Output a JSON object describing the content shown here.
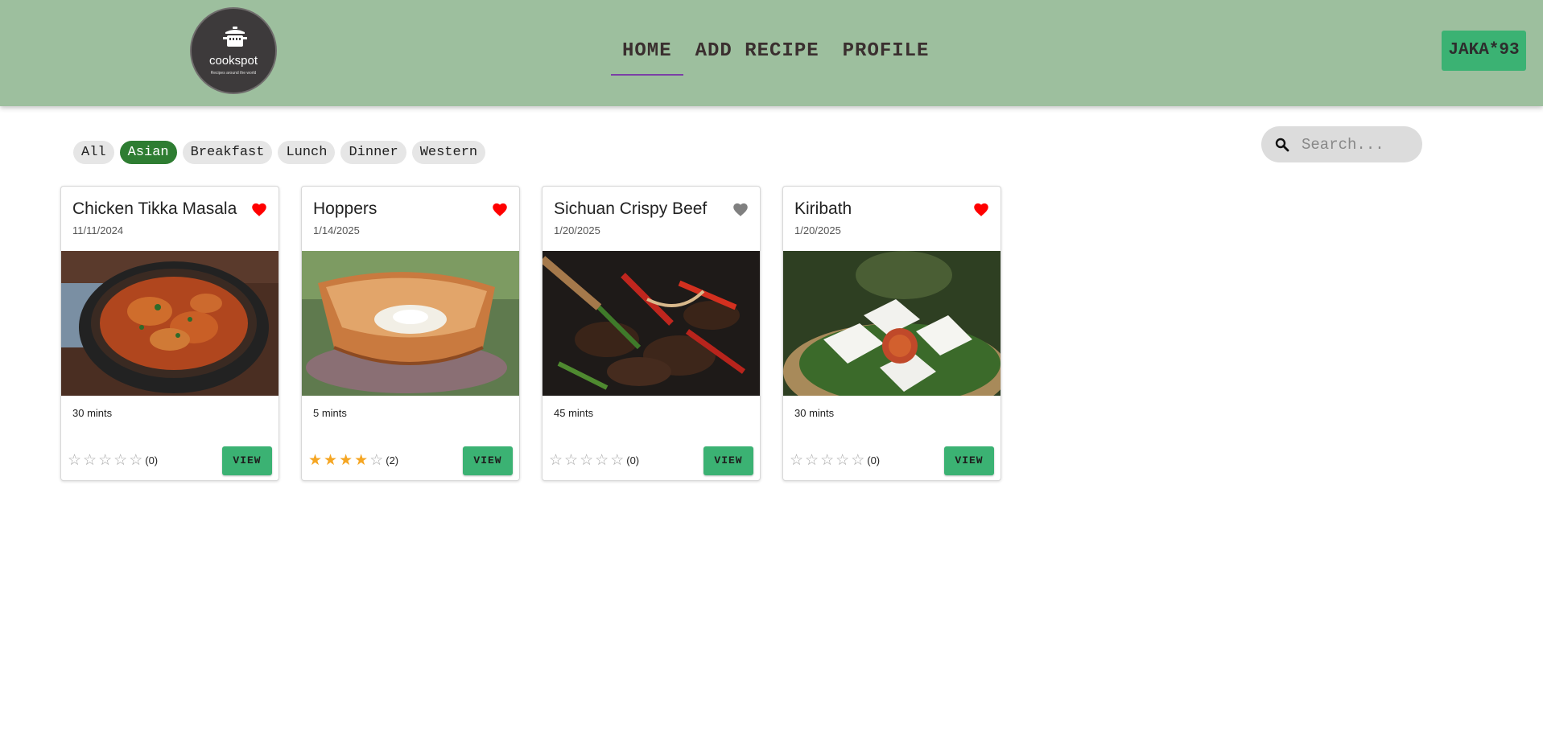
{
  "header": {
    "logo": {
      "name": "cookspot",
      "tagline": "Recipes around the world"
    },
    "nav": [
      {
        "label": "HOME",
        "active": true
      },
      {
        "label": "ADD RECIPE",
        "active": false
      },
      {
        "label": "PROFILE",
        "active": false
      }
    ],
    "user_label": "JAKA*93"
  },
  "filters": [
    {
      "label": "All",
      "active": false
    },
    {
      "label": "Asian",
      "active": true
    },
    {
      "label": "Breakfast",
      "active": false
    },
    {
      "label": "Lunch",
      "active": false
    },
    {
      "label": "Dinner",
      "active": false
    },
    {
      "label": "Western",
      "active": false
    }
  ],
  "search": {
    "placeholder": "Search..."
  },
  "recipes": [
    {
      "title": "Chicken Tikka Masala",
      "date": "11/11/2024",
      "favorite": true,
      "time": "30 mints",
      "rating": 0,
      "rating_count": "(0)",
      "view_label": "VIEW",
      "image": "curry"
    },
    {
      "title": "Hoppers",
      "date": "1/14/2025",
      "favorite": true,
      "time": "5 mints",
      "rating": 4,
      "rating_count": "(2)",
      "view_label": "VIEW",
      "image": "hopper"
    },
    {
      "title": "Sichuan Crispy Beef",
      "date": "1/20/2025",
      "favorite": false,
      "time": "45 mints",
      "rating": 0,
      "rating_count": "(0)",
      "view_label": "VIEW",
      "image": "beef"
    },
    {
      "title": "Kiribath",
      "date": "1/20/2025",
      "favorite": true,
      "time": "30 mints",
      "rating": 0,
      "rating_count": "(0)",
      "view_label": "VIEW",
      "image": "kiribath"
    }
  ],
  "colors": {
    "header_bg": "#9dbf9e",
    "accent_green": "#3bb273",
    "chip_active": "#2e7d32",
    "heart_on": "#ff0000",
    "heart_off": "#808080",
    "star_on": "#f5a623",
    "nav_underline": "#7b3fa6"
  }
}
